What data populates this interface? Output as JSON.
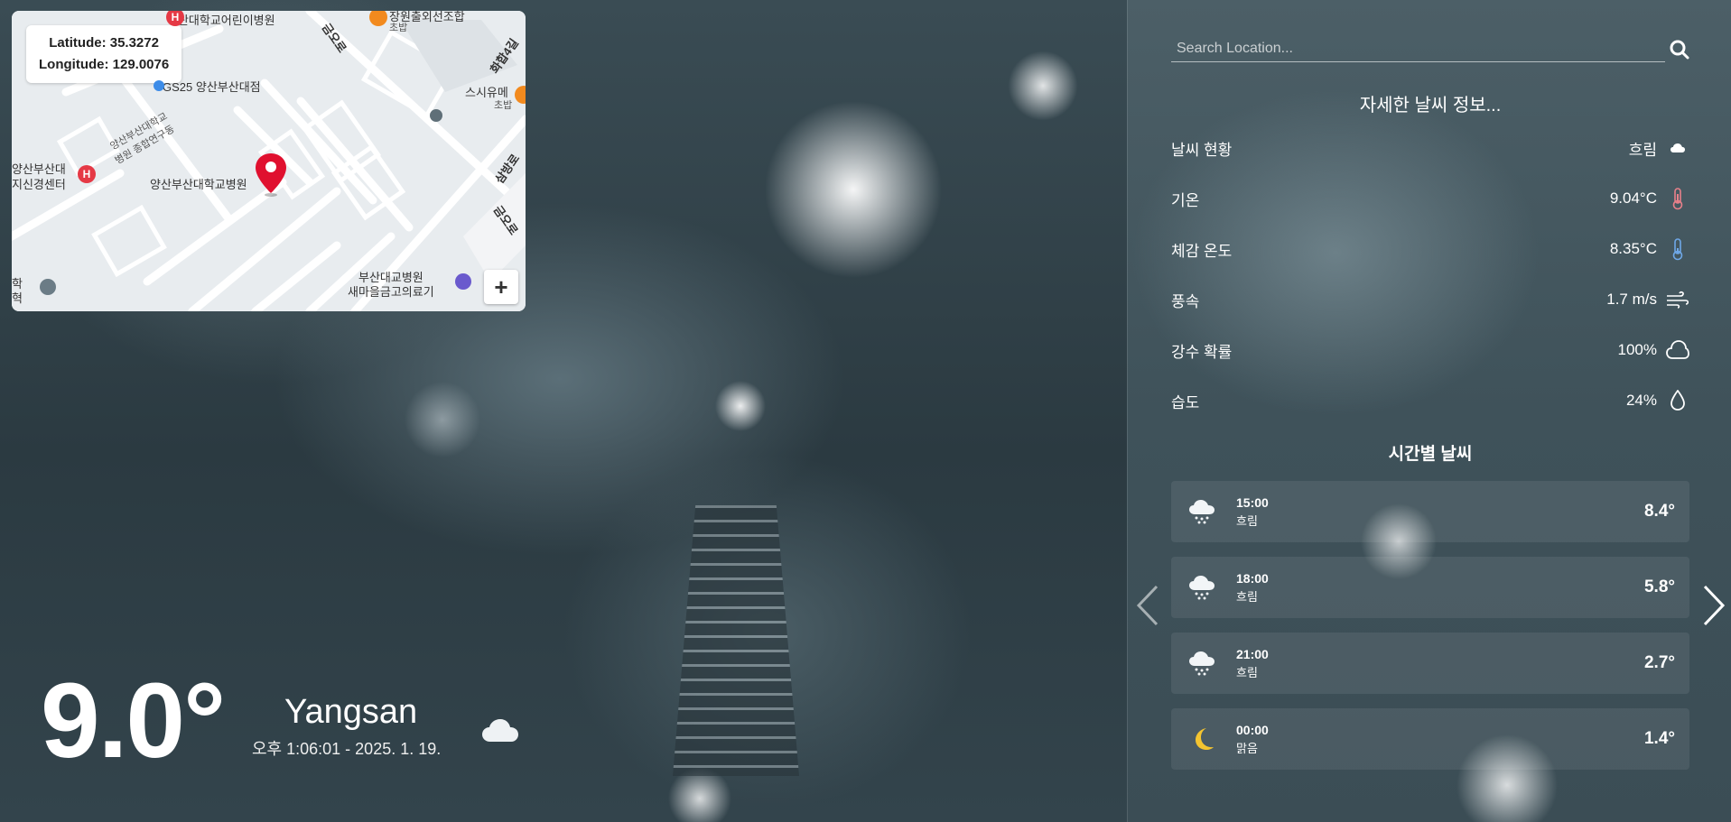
{
  "map": {
    "latitude_label": "Latitude: 35.3272",
    "longitude_label": "Longitude: 129.0076",
    "labels": {
      "childrens_hospital": "부산대학교어린이병원",
      "gs25": "GS25 양산부산대점",
      "hospital_main": "양산부산대학교병원",
      "hospital_side_1": "양산부산대학교",
      "hospital_side_2": "병원 종합연구동",
      "left_1": "양산부산대",
      "left_2": "지신경센터",
      "left_3": "학",
      "left_4": "혁",
      "bottom_1": "부산대교병원",
      "bottom_2": "새마을금고의료기",
      "top_right_1": "장원출외선조합",
      "top_right_2": "초밥",
      "sushi": "스시유메",
      "sushi_sub": "초밥",
      "road_1": "금오로",
      "road_2": "화합4길",
      "road_3": "삼방로",
      "road_4": "금오로"
    },
    "zoom_in": "+"
  },
  "current": {
    "temperature": "9.0°",
    "city": "Yangsan",
    "datetime": "오후 1:06:01 - 2025. 1. 19.",
    "icon": "cloud-icon"
  },
  "search": {
    "placeholder": "Search Location..."
  },
  "details": {
    "title": "자세한 날씨 정보...",
    "rows": [
      {
        "label": "날씨 현황",
        "value": "흐림",
        "icon": "cloud-icon"
      },
      {
        "label": "기온",
        "value": "9.04°C",
        "icon": "thermometer-hot-icon"
      },
      {
        "label": "체감 온도",
        "value": "8.35°C",
        "icon": "thermometer-cold-icon"
      },
      {
        "label": "풍속",
        "value": "1.7 m/s",
        "icon": "wind-icon"
      },
      {
        "label": "강수 확률",
        "value": "100%",
        "icon": "rain-cloud-icon"
      },
      {
        "label": "습도",
        "value": "24%",
        "icon": "droplet-icon"
      }
    ]
  },
  "hourly": {
    "title": "시간별 날씨",
    "items": [
      {
        "time": "15:00",
        "condition": "흐림",
        "temp": "8.4°",
        "icon": "snow-cloud-icon"
      },
      {
        "time": "18:00",
        "condition": "흐림",
        "temp": "5.8°",
        "icon": "snow-cloud-icon"
      },
      {
        "time": "21:00",
        "condition": "흐림",
        "temp": "2.7°",
        "icon": "snow-cloud-icon"
      },
      {
        "time": "00:00",
        "condition": "맑음",
        "temp": "1.4°",
        "icon": "moon-icon"
      }
    ]
  },
  "colors": {
    "pin": "#e0102f",
    "accent_orange": "#f28a1e",
    "hospital_red": "#e53945"
  }
}
